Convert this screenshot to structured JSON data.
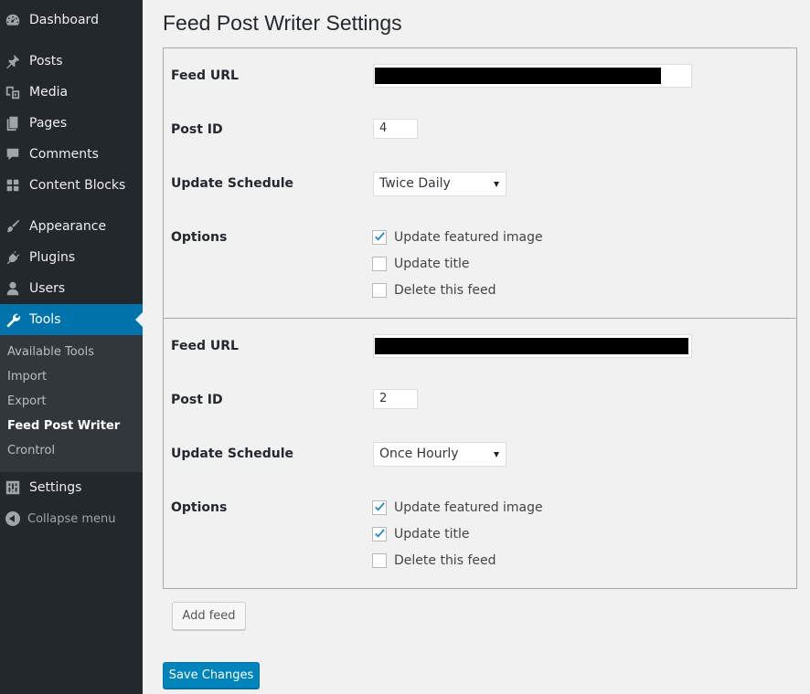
{
  "sidebar": {
    "items": [
      {
        "label": "Dashboard",
        "icon": "dashboard-icon"
      },
      {
        "label": "Posts",
        "icon": "pin-icon"
      },
      {
        "label": "Media",
        "icon": "media-icon"
      },
      {
        "label": "Pages",
        "icon": "pages-icon"
      },
      {
        "label": "Comments",
        "icon": "comments-icon"
      },
      {
        "label": "Content Blocks",
        "icon": "blocks-icon"
      },
      {
        "label": "Appearance",
        "icon": "brush-icon"
      },
      {
        "label": "Plugins",
        "icon": "plugin-icon"
      },
      {
        "label": "Users",
        "icon": "user-icon"
      },
      {
        "label": "Tools",
        "icon": "wrench-icon",
        "current": true
      },
      {
        "label": "Settings",
        "icon": "settings-icon"
      }
    ],
    "submenu": [
      "Available Tools",
      "Import",
      "Export",
      "Feed Post Writer",
      "Crontrol"
    ],
    "submenu_current": "Feed Post Writer",
    "collapse_label": "Collapse menu"
  },
  "page": {
    "title": "Feed Post Writer Settings"
  },
  "labels": {
    "feed_url": "Feed URL",
    "post_id": "Post ID",
    "update_schedule": "Update Schedule",
    "options": "Options"
  },
  "feeds": [
    {
      "feed_url": "",
      "feed_url_redacted": true,
      "post_id": "4",
      "schedule": "Twice Daily",
      "options": [
        {
          "label": "Update featured image",
          "checked": true
        },
        {
          "label": "Update title",
          "checked": false
        },
        {
          "label": "Delete this feed",
          "checked": false
        }
      ]
    },
    {
      "feed_url": "",
      "feed_url_redacted": true,
      "post_id": "2",
      "schedule": "Once Hourly",
      "options": [
        {
          "label": "Update featured image",
          "checked": true
        },
        {
          "label": "Update title",
          "checked": true
        },
        {
          "label": "Delete this feed",
          "checked": false
        }
      ]
    }
  ],
  "buttons": {
    "add_feed": "Add feed",
    "save": "Save Changes"
  },
  "colors": {
    "sidebar_bg": "#23282d",
    "submenu_bg": "#32373c",
    "accent": "#0073aa",
    "primary_button": "#0085ba",
    "redaction": "#000000"
  }
}
